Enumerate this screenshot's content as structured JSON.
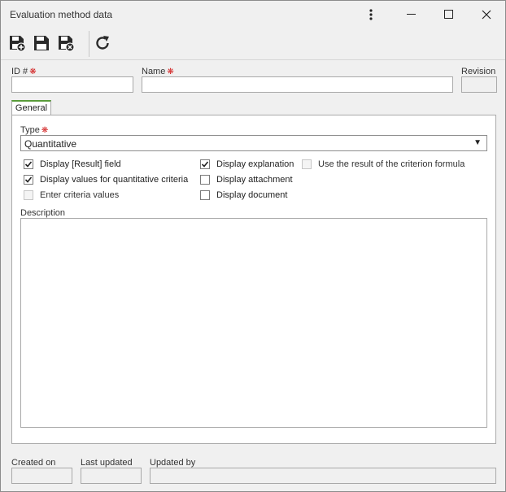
{
  "window": {
    "title": "Evaluation method data",
    "controls": {
      "menu": "more-vert",
      "minimize": "minimize",
      "maximize": "maximize",
      "close": "close"
    }
  },
  "toolbar": {
    "icons": [
      "save-new-icon",
      "save-icon",
      "save-close-icon",
      "refresh-icon"
    ]
  },
  "fields": {
    "id_label": "ID #",
    "id_value": "",
    "name_label": "Name",
    "name_value": "",
    "revision_label": "Revision",
    "revision_value": ""
  },
  "tabs": [
    {
      "label": "General",
      "active": true
    }
  ],
  "general": {
    "type_label": "Type",
    "type_value": "Quantitative",
    "checkboxes": [
      {
        "label": "Display [Result] field",
        "checked": true,
        "enabled": true
      },
      {
        "label": "Display values for quantitative criteria",
        "checked": true,
        "enabled": true
      },
      {
        "label": "Enter criteria values",
        "checked": false,
        "enabled": false
      },
      {
        "label": "Display explanation",
        "checked": true,
        "enabled": true
      },
      {
        "label": "Display attachment",
        "checked": false,
        "enabled": true
      },
      {
        "label": "Display document",
        "checked": false,
        "enabled": true
      },
      {
        "label": "Use the result of the criterion formula",
        "checked": false,
        "enabled": false
      }
    ],
    "description_label": "Description",
    "description_value": ""
  },
  "footer": {
    "created_on_label": "Created on",
    "created_on_value": "",
    "last_updated_label": "Last updated",
    "last_updated_value": "",
    "updated_by_label": "Updated by",
    "updated_by_value": ""
  },
  "colors": {
    "required": "#d21e1e",
    "tab_accent": "#5a9c3b",
    "border": "#a9a9a9"
  }
}
